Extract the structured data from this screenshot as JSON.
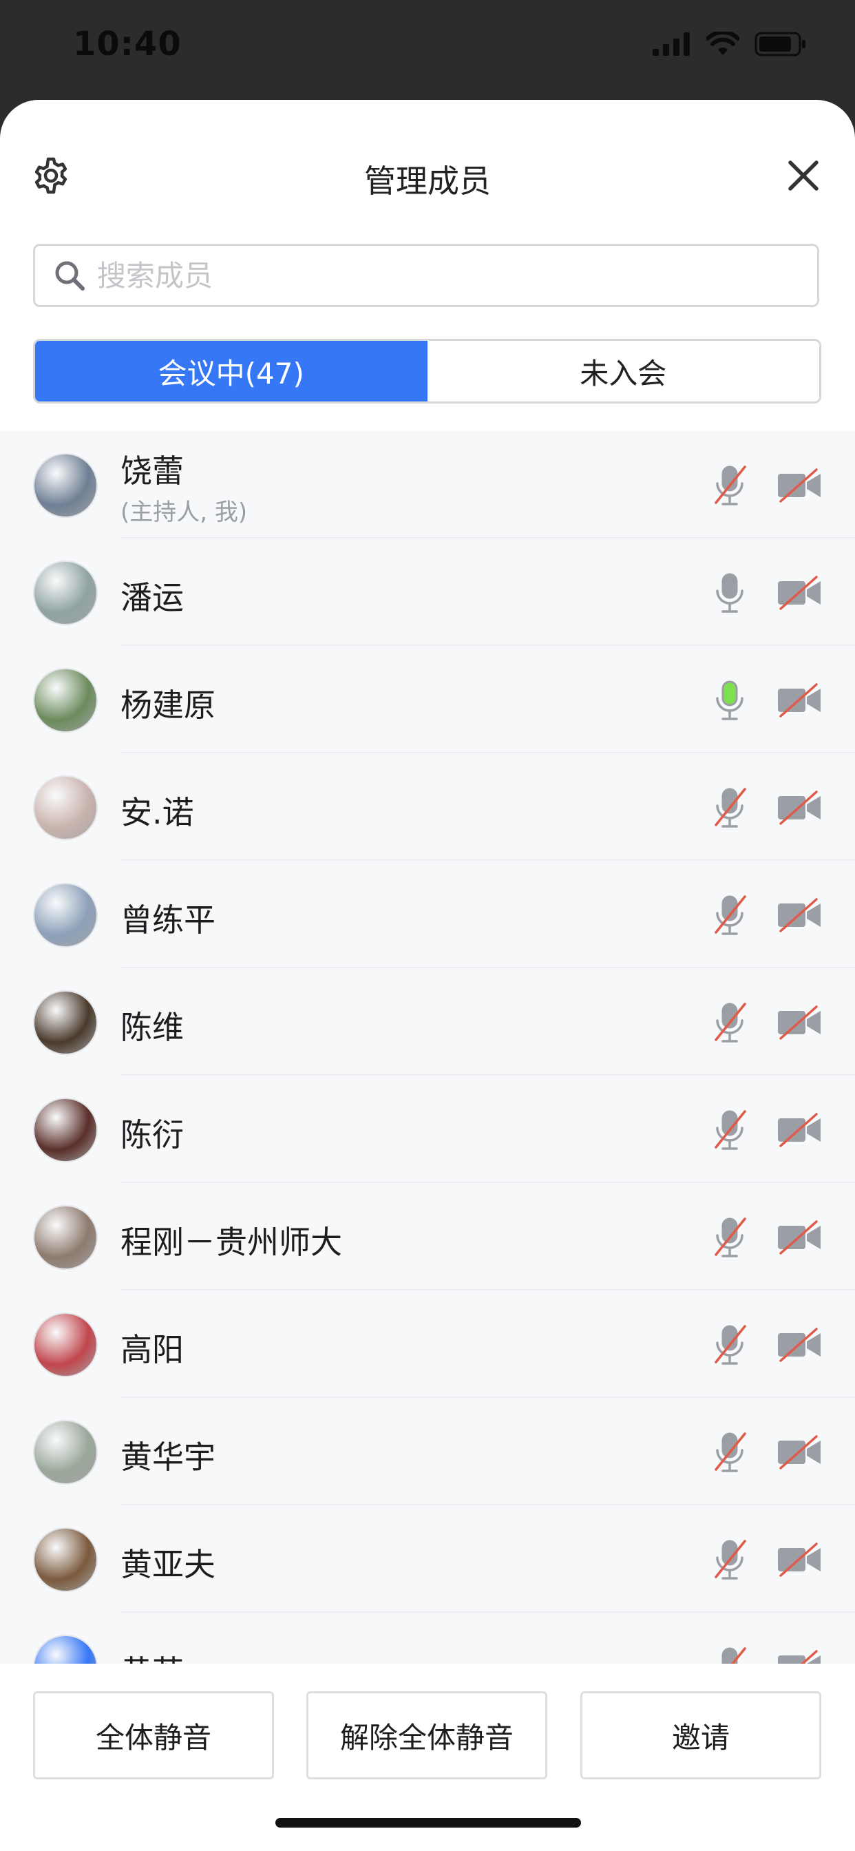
{
  "status_bar": {
    "time": "10:40"
  },
  "header": {
    "title": "管理成员"
  },
  "search": {
    "placeholder": "搜索成员"
  },
  "tabs": [
    {
      "label": "会议中(47)",
      "active": true
    },
    {
      "label": "未入会",
      "active": false
    }
  ],
  "members": [
    {
      "name": "饶蕾",
      "sub": "(主持人, 我)",
      "mic": "muted",
      "cam": "off",
      "avatar_color": "#6f7f94"
    },
    {
      "name": "潘运",
      "sub": "",
      "mic": "on",
      "cam": "off",
      "avatar_color": "#8fa3a0"
    },
    {
      "name": "杨建原",
      "sub": "",
      "mic": "speaking",
      "cam": "off",
      "avatar_color": "#6b8b5c"
    },
    {
      "name": "安.诺",
      "sub": "",
      "mic": "muted",
      "cam": "off",
      "avatar_color": "#c9b3ad"
    },
    {
      "name": "曾练平",
      "sub": "",
      "mic": "muted",
      "cam": "off",
      "avatar_color": "#8ca0b8"
    },
    {
      "name": "陈维",
      "sub": "",
      "mic": "muted",
      "cam": "off",
      "avatar_color": "#4a3a2c"
    },
    {
      "name": "陈衍",
      "sub": "",
      "mic": "muted",
      "cam": "off",
      "avatar_color": "#5a2f2a"
    },
    {
      "name": "程刚－贵州师大",
      "sub": "",
      "mic": "muted",
      "cam": "off",
      "avatar_color": "#8d7a6d"
    },
    {
      "name": "高阳",
      "sub": "",
      "mic": "muted",
      "cam": "off",
      "avatar_color": "#c0464c"
    },
    {
      "name": "黄华宇",
      "sub": "",
      "mic": "muted",
      "cam": "off",
      "avatar_color": "#9aa79a"
    },
    {
      "name": "黄亚夫",
      "sub": "",
      "mic": "muted",
      "cam": "off",
      "avatar_color": "#7b5a3d"
    },
    {
      "name": "黄若",
      "sub": "",
      "mic": "muted",
      "cam": "off",
      "avatar_color": "#3677f6"
    }
  ],
  "bottom_buttons": {
    "mute_all": "全体静音",
    "unmute_all": "解除全体静音",
    "invite": "邀请"
  },
  "colors": {
    "accent": "#3677f6",
    "muted_slash": "#e05a4a",
    "speaking": "#7ee04f",
    "icon_grey": "#9b9ea4"
  },
  "icons": [
    "gear-icon",
    "close-icon",
    "search-icon",
    "microphone-icon",
    "video-camera-icon"
  ]
}
